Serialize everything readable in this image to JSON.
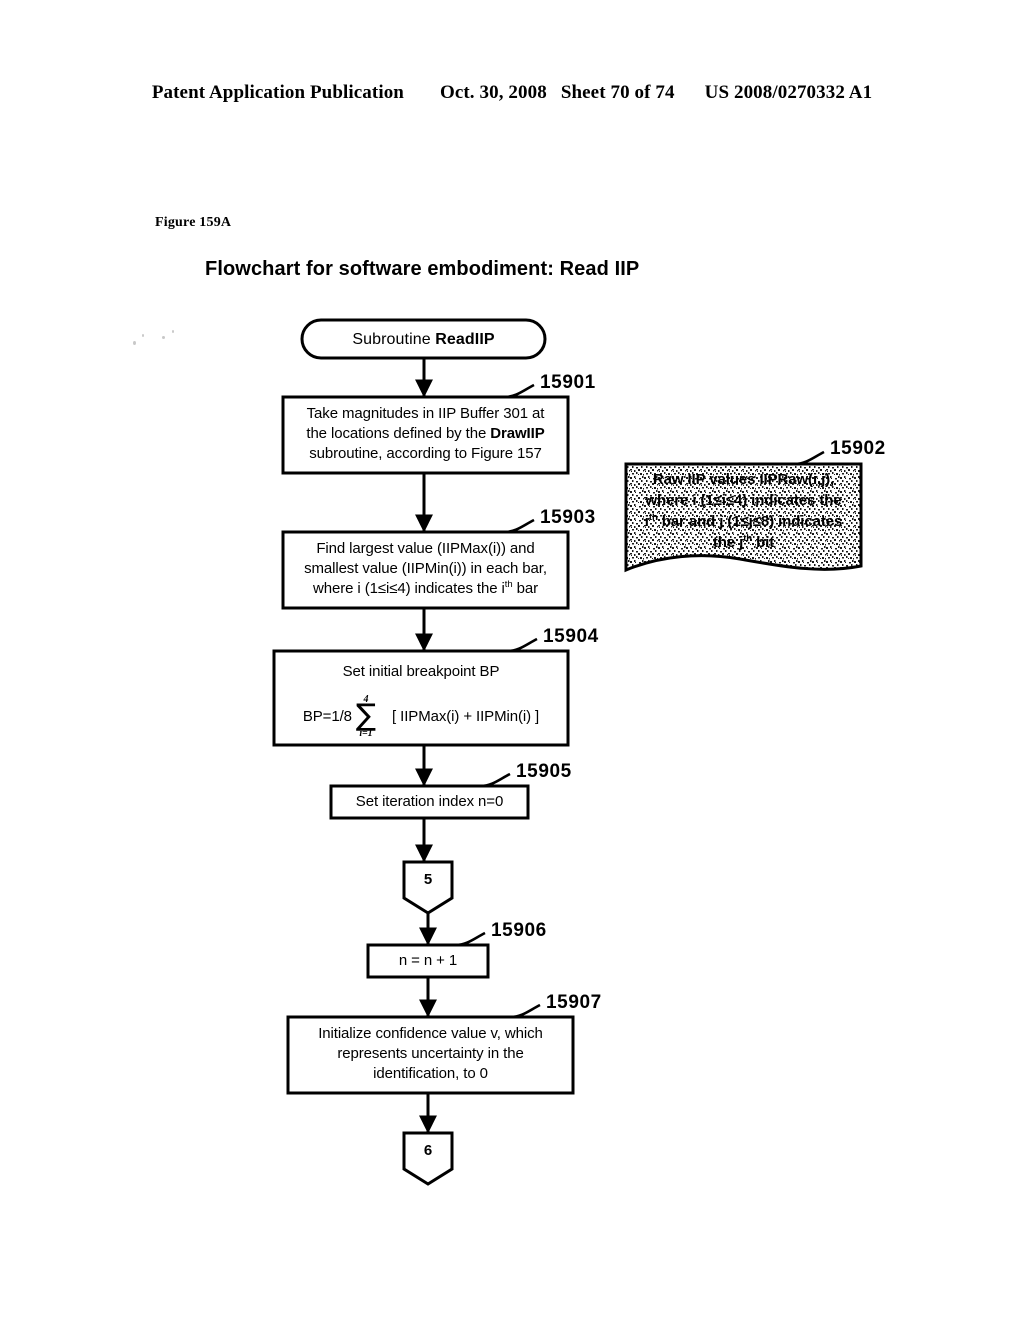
{
  "header": {
    "publication": "Patent Application Publication",
    "date": "Oct. 30, 2008",
    "sheet": "Sheet 70 of 74",
    "patent_number": "US 2008/0270332 A1"
  },
  "figure": {
    "label": "Figure 159A",
    "title": "Flowchart for software embodiment: Read IIP"
  },
  "flowchart": {
    "start": {
      "shape": "terminator-oval",
      "text_plain": "Subroutine ReadIIP",
      "text_normal": "Subroutine ",
      "text_bold": "ReadIIP"
    },
    "steps": [
      {
        "ref": "15901",
        "shape": "process",
        "line1": "Take magnitudes in IIP Buffer 301 at",
        "line2_a": "the locations defined by the ",
        "line2_bold": "DrawIIP",
        "line3": "subroutine, according to Figure 157"
      },
      {
        "ref": "15903",
        "shape": "process",
        "line1": "Find largest value (IIPMax(i)) and",
        "line2": "smallest value (IIPMin(i)) in each bar,",
        "line3_a": "where i (1≤i≤4) indicates the i",
        "line3_sup": "th",
        "line3_b": " bar"
      },
      {
        "ref": "15904",
        "shape": "process",
        "line1": "Set initial breakpoint BP",
        "formula_lead": "BP=1/8",
        "formula_sigma_top": "4",
        "formula_sigma": "∑",
        "formula_sigma_bottom": "i=1",
        "formula_body": "[ IIPMax(i) + IIPMin(i) ]"
      },
      {
        "ref": "15905",
        "shape": "process",
        "line1": "Set iteration index n=0"
      },
      {
        "ref": "15906",
        "shape": "process",
        "line1": "n = n + 1"
      },
      {
        "ref": "15907",
        "shape": "process",
        "line1": "Initialize confidence value v, which",
        "line2": "represents uncertainty in the",
        "line3": "identification, to 0"
      }
    ],
    "data_annotation": {
      "ref": "15902",
      "shape": "document-wavy",
      "line1": "Raw IIP values IIPRaw(i,j),",
      "line2": "where  i (1≤i≤4) indicates the",
      "line3_a": "i",
      "line3_sup1": "th",
      "line3_b": " bar and  j (1≤j≤8) indicates",
      "line4_a": "the j",
      "line4_sup": "th",
      "line4_b": " bit"
    },
    "connectors": [
      {
        "id": "connector-5",
        "label": "5",
        "shape": "pentagon-down"
      },
      {
        "id": "connector-6",
        "label": "6",
        "shape": "pentagon-down"
      }
    ]
  },
  "colors": {
    "ink": "#000000",
    "paper": "#ffffff",
    "stipple_gray": "#8c8c8c"
  }
}
